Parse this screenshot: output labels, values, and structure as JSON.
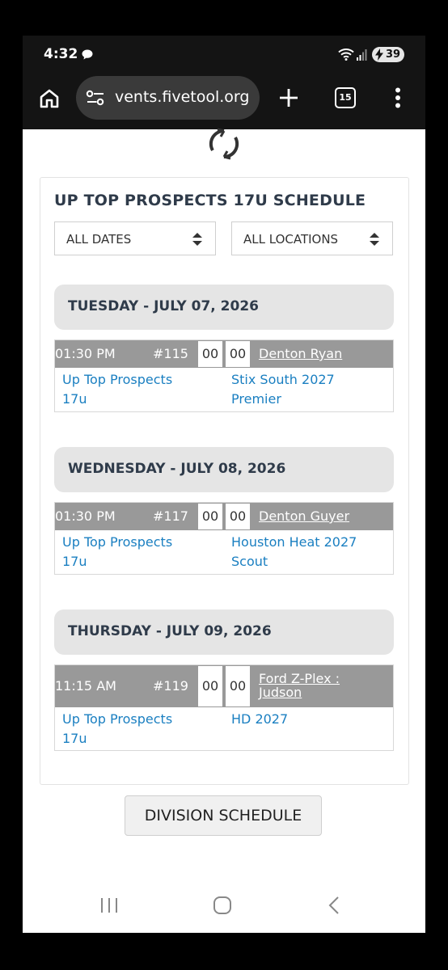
{
  "status": {
    "time": "4:32",
    "battery": "39"
  },
  "browser": {
    "url": "vents.fivetool.org",
    "tab_count": "15"
  },
  "schedule": {
    "title": "UP TOP PROSPECTS 17U SCHEDULE",
    "date_filter": "ALL DATES",
    "location_filter": "ALL LOCATIONS",
    "days": [
      {
        "heading": "TUESDAY - JULY 07, 2026",
        "game": {
          "time": "01:30 PM",
          "number": "#115",
          "score_home": "00",
          "score_away": "00",
          "location": "Denton Ryan",
          "home_team": "Up Top Prospects 17u",
          "away_team": "Stix South 2027 Premier"
        }
      },
      {
        "heading": "WEDNESDAY - JULY 08, 2026",
        "game": {
          "time": "01:30 PM",
          "number": "#117",
          "score_home": "00",
          "score_away": "00",
          "location": "Denton Guyer",
          "home_team": "Up Top Prospects 17u",
          "away_team": "Houston Heat 2027 Scout"
        }
      },
      {
        "heading": "THURSDAY - JULY 09, 2026",
        "game": {
          "time": "11:15 AM",
          "number": "#119",
          "score_home": "00",
          "score_away": "00",
          "location": "Ford Z-Plex : Judson",
          "home_team": "Up Top Prospects 17u",
          "away_team": "HD 2027"
        }
      }
    ],
    "division_button": "DIVISION SCHEDULE"
  },
  "colors": {
    "heading": "#2f3b4a",
    "link": "#1a7fc1",
    "bar": "#999999",
    "day_bg": "#e5e5e5"
  }
}
